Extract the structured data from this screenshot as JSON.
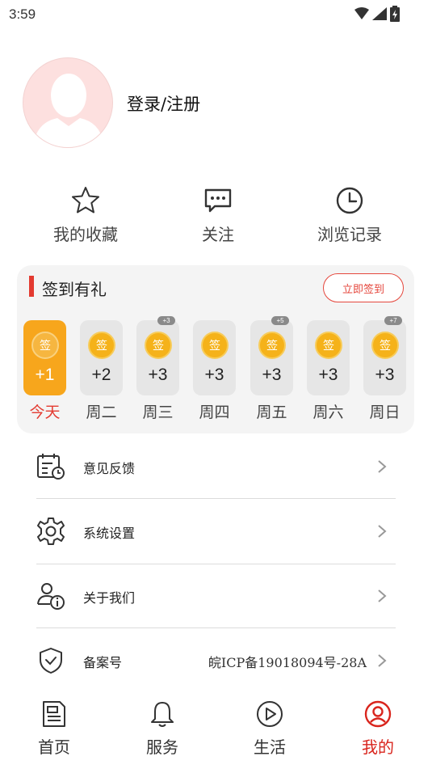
{
  "status_bar": {
    "time": "3:59"
  },
  "profile": {
    "login_label": "登录/注册"
  },
  "quick_actions": [
    {
      "label": "我的收藏",
      "icon": "star-icon"
    },
    {
      "label": "关注",
      "icon": "chat-icon"
    },
    {
      "label": "浏览记录",
      "icon": "clock-icon"
    }
  ],
  "signin": {
    "title": "签到有礼",
    "button": "立即签到",
    "coin_char": "签",
    "days": [
      {
        "label": "今天",
        "points": "+1",
        "badge": ""
      },
      {
        "label": "周二",
        "points": "+2",
        "badge": ""
      },
      {
        "label": "周三",
        "points": "+3",
        "badge": "+3"
      },
      {
        "label": "周四",
        "points": "+3",
        "badge": ""
      },
      {
        "label": "周五",
        "points": "+3",
        "badge": "+5"
      },
      {
        "label": "周六",
        "points": "+3",
        "badge": ""
      },
      {
        "label": "周日",
        "points": "+3",
        "badge": "+7"
      }
    ]
  },
  "menu": [
    {
      "label": "意见反馈",
      "value": "",
      "icon": "calendar-feedback-icon"
    },
    {
      "label": "系统设置",
      "value": "",
      "icon": "gear-icon"
    },
    {
      "label": "关于我们",
      "value": "",
      "icon": "user-info-icon"
    },
    {
      "label": "备案号",
      "value": "皖ICP备19018094号-28A",
      "icon": "shield-check-icon"
    }
  ],
  "bottom_nav": [
    {
      "label": "首页",
      "icon": "document-icon",
      "active": false
    },
    {
      "label": "服务",
      "icon": "bell-icon",
      "active": false
    },
    {
      "label": "生活",
      "icon": "play-icon",
      "active": false
    },
    {
      "label": "我的",
      "icon": "user-circle-icon",
      "active": true
    }
  ],
  "colors": {
    "accent": "#e33a30",
    "today": "#f7a61c",
    "coin": "#f5b21a"
  }
}
